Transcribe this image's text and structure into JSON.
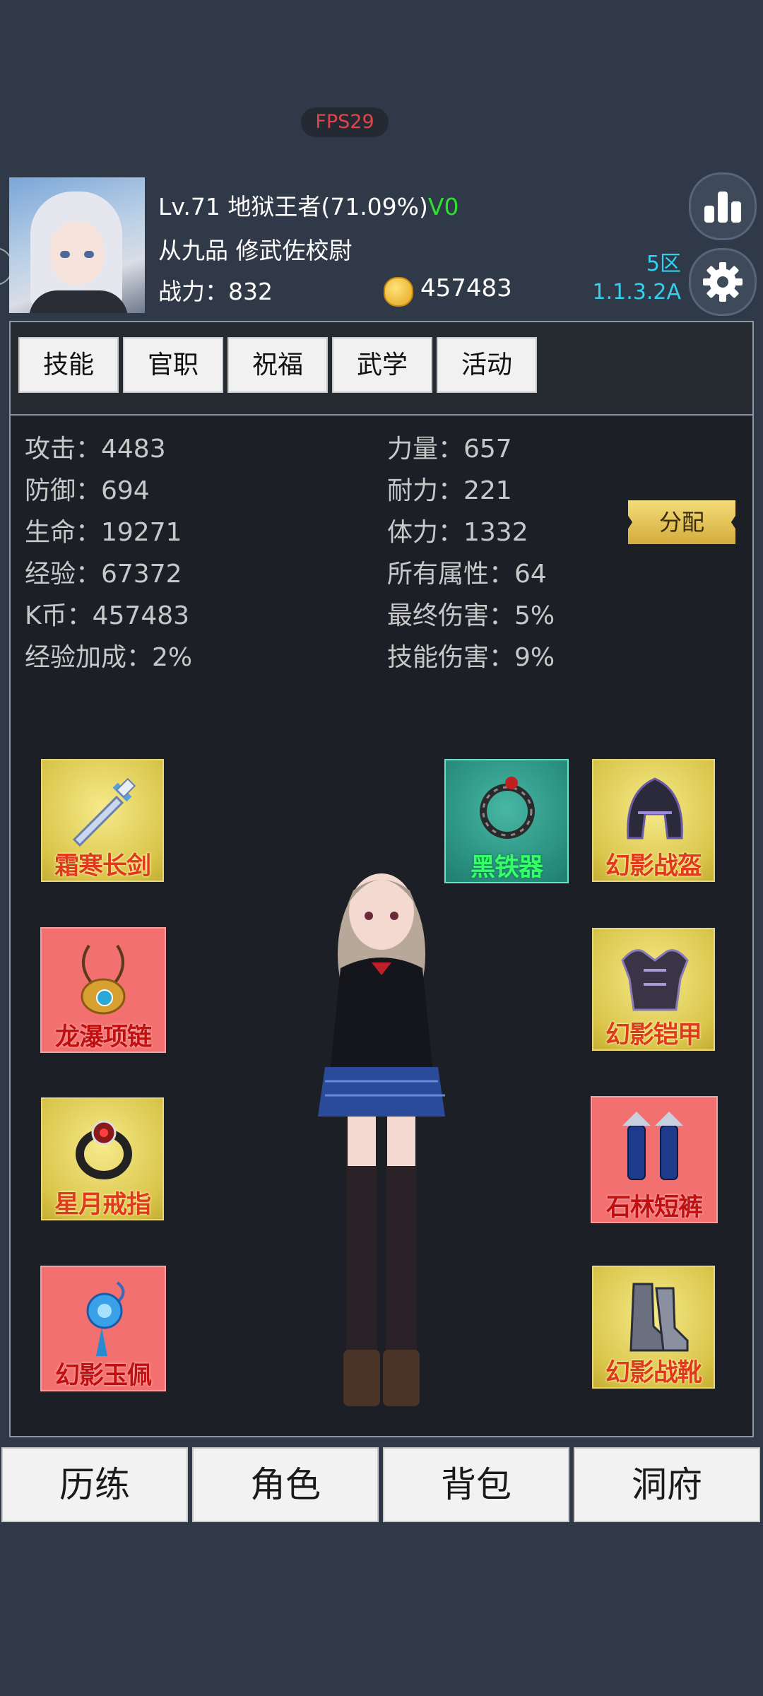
{
  "fps": "FPS29",
  "player": {
    "level_line": "Lv.71 地狱王者(71.09%)",
    "vip": "V0",
    "rank": "从九品 修武佐校尉",
    "power": "战力：832",
    "coins": "457483"
  },
  "server": {
    "zone": "5区",
    "version": "1.1.3.2A"
  },
  "tabs": [
    "技能",
    "官职",
    "祝福",
    "武学",
    "活动"
  ],
  "stats_left": [
    "攻击：4483",
    "防御：694",
    "生命：19271",
    "经验：67372",
    "K币：457483",
    "经验加成：2%"
  ],
  "stats_right": [
    "力量：657",
    "耐力：221",
    "体力：1332",
    "所有属性：64",
    "最终伤害：5%",
    "技能伤害：9%"
  ],
  "assign_label": "分配",
  "equipment": {
    "weapon": "霜寒长剑",
    "necklace": "龙瀑项链",
    "ring": "星月戒指",
    "pendant": "幻影玉佩",
    "artifact": "黑铁器",
    "helmet": "幻影战盔",
    "armor": "幻影铠甲",
    "pants": "石林短裤",
    "boots": "幻影战靴"
  },
  "bottom_nav": [
    "历练",
    "角色",
    "背包",
    "洞府"
  ],
  "colors": {
    "background": "#2f3947",
    "panel": "#1d1f26",
    "server_text": "#33d0f0",
    "vip": "#2ee02e"
  }
}
